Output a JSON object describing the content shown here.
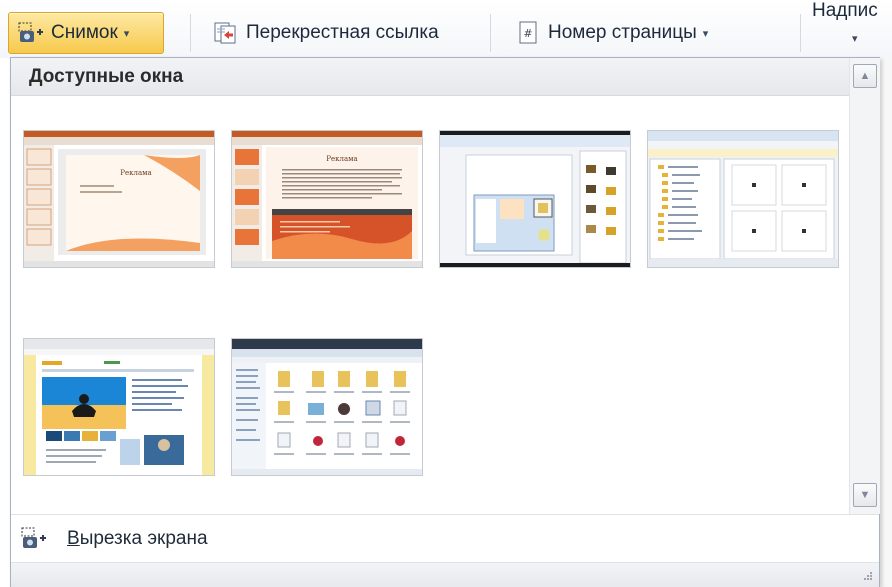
{
  "ribbon": {
    "screenshot_label": "Снимок",
    "cross_reference_label": "Перекрестная ссылка",
    "page_number_label": "Номер страницы",
    "caption_label": "Надпис",
    "dropdown_caret": "▾"
  },
  "panel": {
    "header": "Доступные окна",
    "footer_label": "Вырезка экрана",
    "footer_hotkey": "В",
    "footer_rest": "ырезка экрана"
  },
  "thumbnails": [
    {
      "name": "powerpoint-window-1",
      "slide_title": "Реклама"
    },
    {
      "name": "powerpoint-window-2",
      "slide_title": "Реклама"
    },
    {
      "name": "paint-window-3"
    },
    {
      "name": "explorer-window-4"
    },
    {
      "name": "browser-window-5"
    },
    {
      "name": "explorer-window-6"
    }
  ],
  "colors": {
    "accent_orange": "#e8732a",
    "selected_button": "#f7c94c",
    "panel_border": "#a7b3c2"
  },
  "icons": {
    "screenshot": "camera-plus-icon",
    "cross_reference": "cross-reference-icon",
    "page_number": "page-number-icon",
    "scroll_up": "arrow-up-icon",
    "scroll_down": "arrow-down-icon",
    "resize_grip": "resize-grip-icon"
  }
}
